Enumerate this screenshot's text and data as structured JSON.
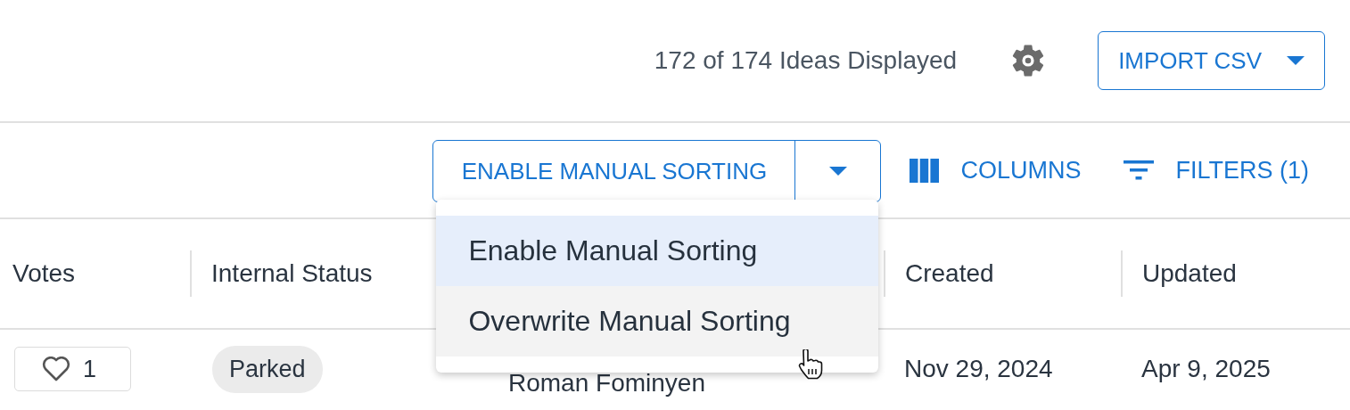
{
  "header": {
    "count": "172 of 174 Ideas Displayed",
    "import_button": "IMPORT CSV"
  },
  "toolbar": {
    "split_button": "ENABLE MANUAL SORTING",
    "columns_button": "COLUMNS",
    "filters_button": "FILTERS (1)"
  },
  "sort_menu": {
    "open": true,
    "items": [
      {
        "label": "Enable Manual Sorting",
        "selected": true,
        "hovered": false
      },
      {
        "label": "Overwrite Manual Sorting",
        "selected": false,
        "hovered": true
      }
    ]
  },
  "table": {
    "columns": [
      "Votes",
      "Internal Status",
      "Created",
      "Updated"
    ],
    "rows": [
      {
        "votes": "1",
        "status": "Parked",
        "author": "Roman Fominyen",
        "created": "Nov 29, 2024",
        "updated": "Apr 9, 2025"
      }
    ]
  }
}
